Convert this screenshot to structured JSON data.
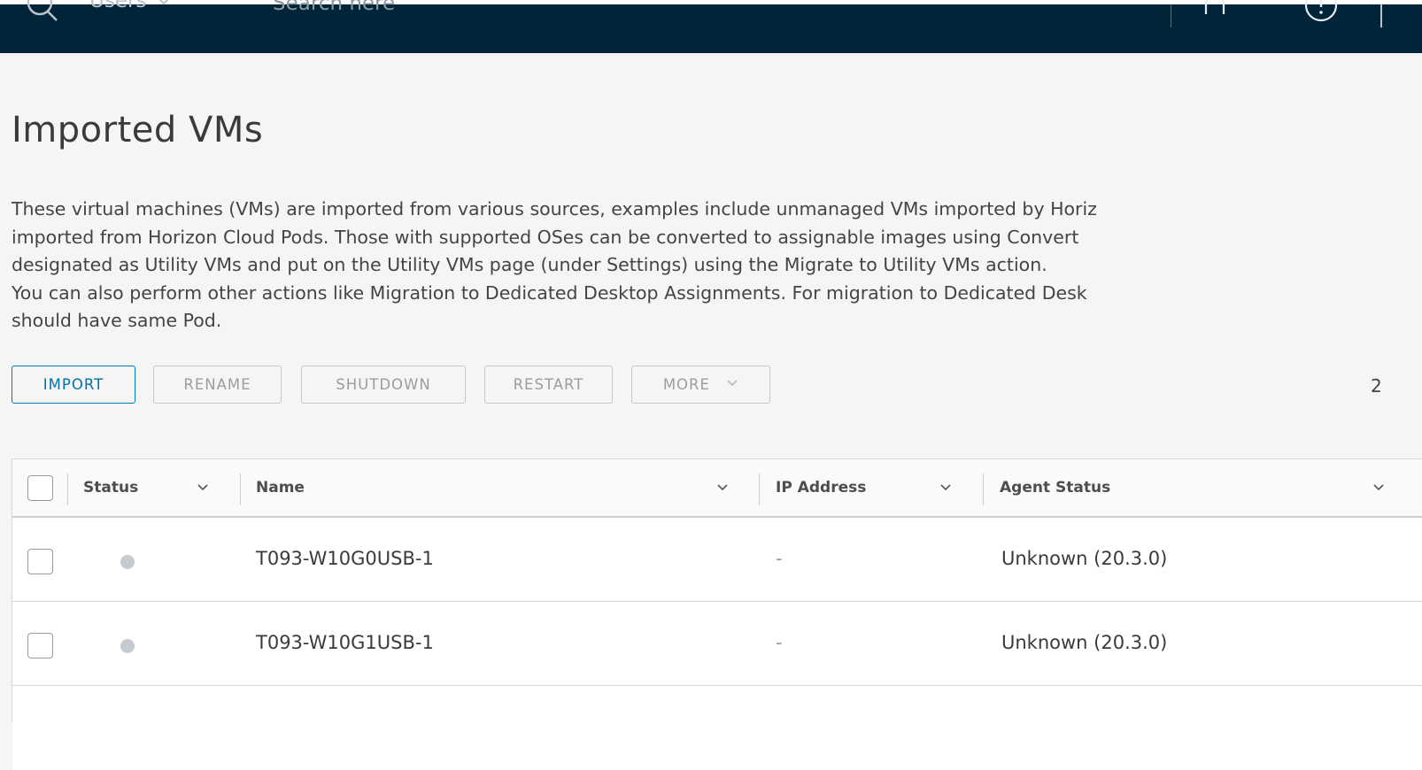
{
  "header": {
    "scope_label": "Users",
    "search_placeholder": "Search here"
  },
  "page": {
    "title": "Imported VMs",
    "description_lines": [
      "These virtual machines (VMs) are imported from various sources, examples include unmanaged VMs imported by Horiz",
      "imported from Horizon Cloud Pods. Those with supported OSes can be converted to assignable images using Convert",
      "designated as Utility VMs and put on the Utility VMs page (under Settings) using the Migrate to Utility VMs action.",
      "You can also perform other actions like Migration to Dedicated Desktop Assignments. For migration to Dedicated Desk",
      "should have same Pod."
    ]
  },
  "toolbar": {
    "import_label": "IMPORT",
    "rename_label": "RENAME",
    "shutdown_label": "SHUTDOWN",
    "restart_label": "RESTART",
    "more_label": "MORE",
    "count_text": "2"
  },
  "grid": {
    "columns": {
      "status": "Status",
      "name": "Name",
      "ip_address": "IP Address",
      "agent_status": "Agent Status"
    },
    "rows": [
      {
        "name": "T093-W10G0USB-1",
        "ip": "-",
        "agent_status": "Unknown (20.3.0)",
        "status_color": "#c5cbd1"
      },
      {
        "name": "T093-W10G1USB-1",
        "ip": "-",
        "agent_status": "Unknown (20.3.0)",
        "status_color": "#c5cbd1"
      }
    ]
  },
  "colors": {
    "header_bg": "#002538",
    "primary": "#0079b8",
    "page_bg": "#f5f5f5"
  },
  "icons": [
    "search-icon",
    "chevron-down-icon",
    "bell-icon",
    "help-icon"
  ]
}
